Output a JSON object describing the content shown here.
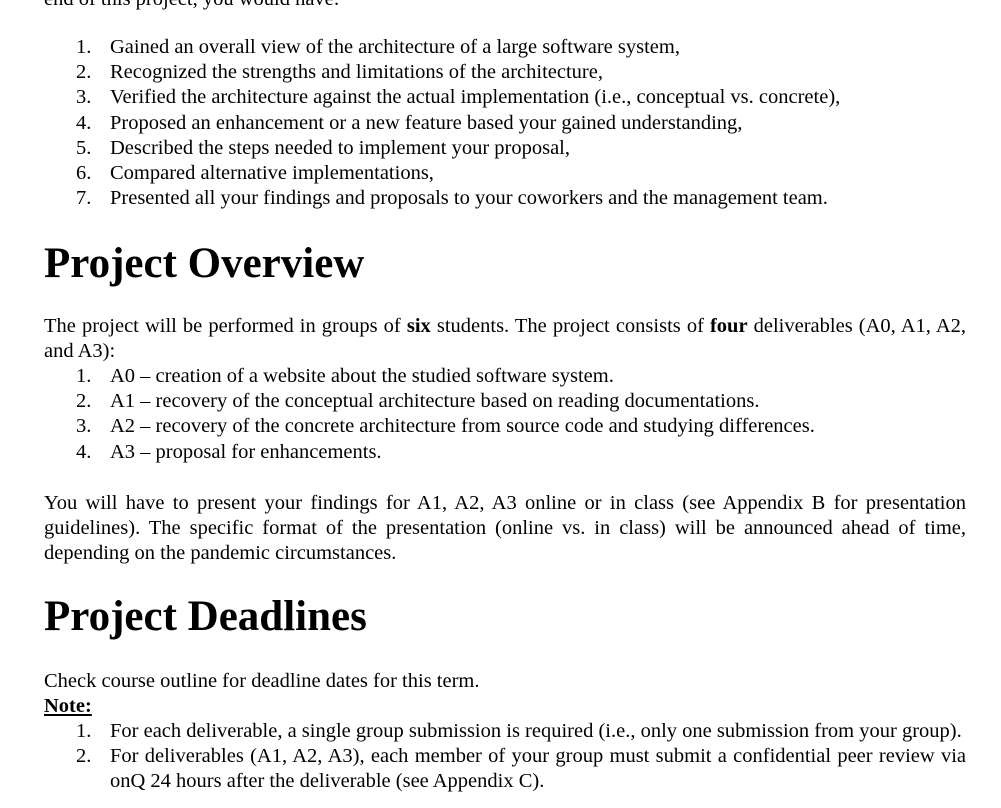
{
  "top_fragment": "end of this project, you would have:",
  "outcomes": [
    "Gained an overall view of the architecture of a large software system,",
    "Recognized the strengths and limitations of the architecture,",
    "Verified the architecture against the actual implementation (i.e., conceptual vs. concrete),",
    "Proposed an enhancement or a new feature based your gained understanding,",
    "Described the steps needed to implement your proposal,",
    "Compared alternative implementations,",
    "Presented all your findings and proposals to your coworkers and the management team."
  ],
  "overview": {
    "heading": "Project Overview",
    "intro_a": "The project will be performed in groups of ",
    "intro_group_size": "six",
    "intro_b": " students. The project consists of ",
    "intro_count": "four",
    "intro_c": " deliverables (A0, A1, A2, and A3):",
    "deliverables": [
      "A0 – creation of a website about the studied software system.",
      "A1 – recovery of the conceptual architecture based on reading documentations.",
      "A2 – recovery of the concrete architecture from source code and studying differences.",
      "A3 – proposal for enhancements."
    ],
    "presentation_text": "You will have to present your findings for A1, A2, A3 online or in class (see Appendix B for presentation guidelines). The specific format of the presentation (online vs. in class) will be announced ahead of time, depending on the pandemic circumstances."
  },
  "deadlines": {
    "heading": "Project Deadlines",
    "text": "Check course outline for deadline dates for this term.",
    "note_label": "Note:",
    "notes": [
      "For each deliverable, a single group submission is required (i.e., only one submission from your group).",
      "For deliverables (A1, A2, A3), each member of your group must submit a confidential peer review via onQ 24 hours after the deliverable (see Appendix C)."
    ]
  }
}
